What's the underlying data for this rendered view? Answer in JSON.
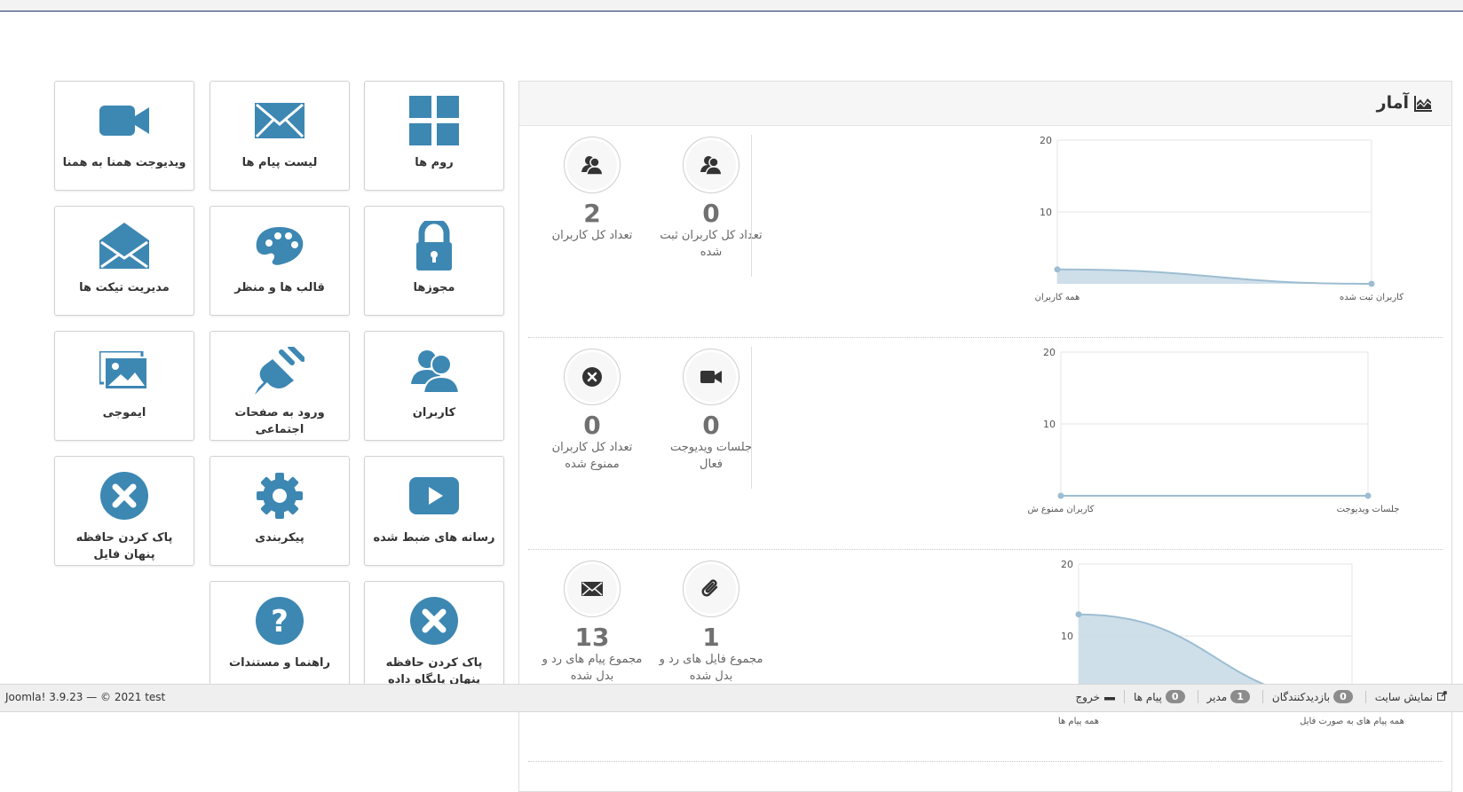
{
  "tiles": {
    "rooms": "روم ها",
    "messages_list": "لیست پیام ها",
    "video_widget": "ویدیوجت همنا به همنا",
    "permissions": "مجوزها",
    "themes": "قالب ها و منظر",
    "ticket_manager": "مدیریت تیکت ها",
    "users": "کاربران",
    "social_login": "ورود به صفحات اجتماعی",
    "emoji": "ایموجی",
    "recorded_media": "رسانه های ضبط شده",
    "configuration": "پیکربندی",
    "clear_file_cache": "پاک کردن حافظه پنهان فایل",
    "clear_db_cache": "پاک کردن حافظه پنهان پایگاه داده",
    "help": "راهنما و مستندات"
  },
  "panel": {
    "title": "آمار"
  },
  "stats": [
    {
      "right_value": "0",
      "right_label": "تعداد کل کاربران ثبت شده",
      "left_value": "2",
      "left_label": "تعداد کل کاربران"
    },
    {
      "right_value": "0",
      "right_label": "جلسات ویدیوجت فعال",
      "left_value": "0",
      "left_label": "تعداد کل کاربران ممنوع شده"
    },
    {
      "right_value": "1",
      "right_label": "مجموع فایل های رد و بدل شده",
      "left_value": "13",
      "left_label": "مجموع پیام های رد و بدل شده"
    }
  ],
  "chart_data": [
    {
      "type": "area",
      "categories": [
        "کاربران ثبت شده",
        "همه کاربران"
      ],
      "values": [
        0,
        2
      ],
      "yticks": [
        "20",
        "10"
      ],
      "ylim": [
        0,
        20
      ],
      "grid": true,
      "color": "#c5d9e6"
    },
    {
      "type": "area",
      "categories": [
        "جلسات ویدیوجت",
        "کاربران ممنوع ش"
      ],
      "values": [
        0,
        0
      ],
      "yticks": [
        "20",
        "10"
      ],
      "ylim": [
        0,
        20
      ],
      "grid": true,
      "color": "#c5d9e6"
    },
    {
      "type": "area",
      "categories": [
        "همه پیام های به صورت فایل",
        "همه پیام ها"
      ],
      "values": [
        1,
        13
      ],
      "yticks": [
        "20",
        "10"
      ],
      "ylim": [
        0,
        20
      ],
      "grid": true,
      "color": "#c5d9e6"
    }
  ],
  "statusbar": {
    "copyright": "Joomla! 3.9.23  —  © 2021 test",
    "view_site": "نمایش سایت",
    "visitors_count": "0",
    "visitors_label": "بازدیدکنندگان",
    "admins_count": "1",
    "admins_label": "مدیر",
    "messages_count": "0",
    "messages_label": "پیام ها",
    "logout": "خروج"
  },
  "colors": {
    "icon_blue": "#3d87b3",
    "accent": "#1a3867"
  }
}
